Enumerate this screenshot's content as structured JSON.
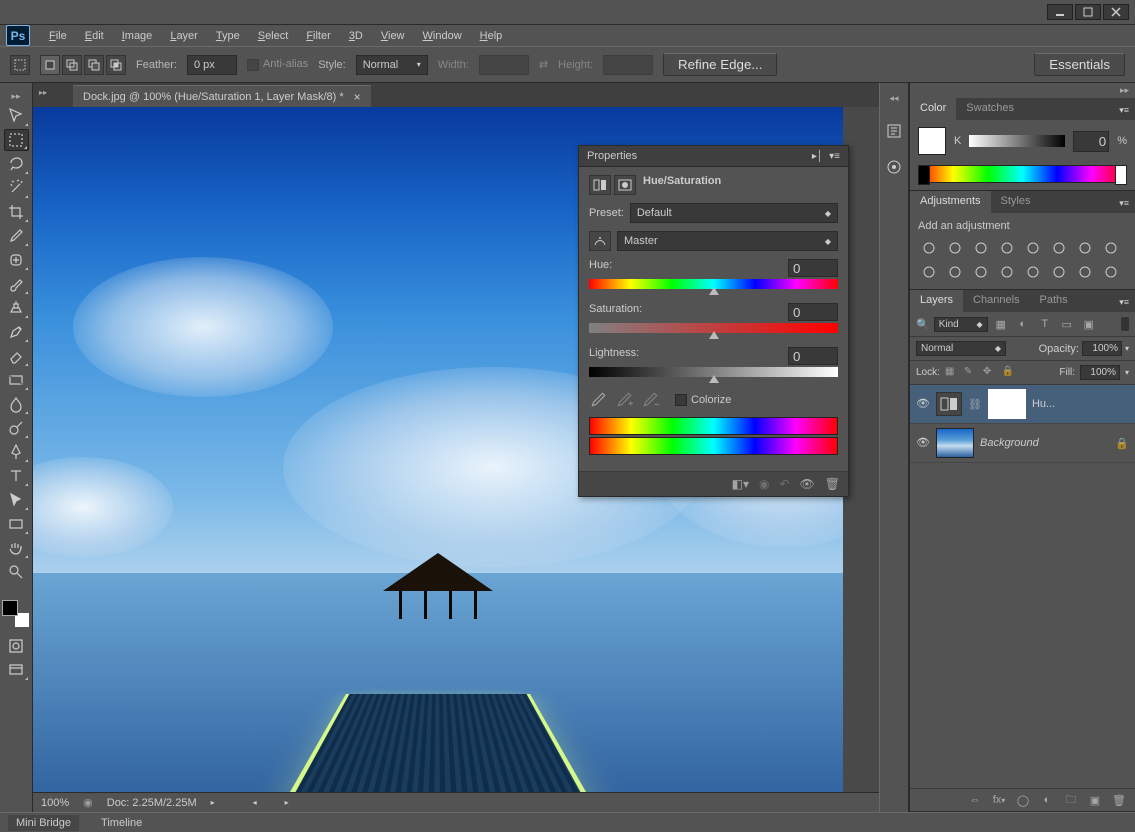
{
  "menubar": [
    "File",
    "Edit",
    "Image",
    "Layer",
    "Type",
    "Select",
    "Filter",
    "3D",
    "View",
    "Window",
    "Help"
  ],
  "optbar": {
    "feather_label": "Feather:",
    "feather_value": "0 px",
    "antialias_label": "Anti-alias",
    "style_label": "Style:",
    "style_value": "Normal",
    "width_label": "Width:",
    "height_label": "Height:",
    "refine_btn": "Refine Edge...",
    "essentials_btn": "Essentials"
  },
  "doc": {
    "tab_title": "Dock.jpg @ 100% (Hue/Saturation 1, Layer Mask/8) *"
  },
  "properties": {
    "title": "Properties",
    "subtitle": "Hue/Saturation",
    "preset_label": "Preset:",
    "preset_value": "Default",
    "channel_value": "Master",
    "hue_label": "Hue:",
    "hue_value": "0",
    "sat_label": "Saturation:",
    "sat_value": "0",
    "light_label": "Lightness:",
    "light_value": "0",
    "colorize_label": "Colorize"
  },
  "color_panel": {
    "tab_color": "Color",
    "tab_swatches": "Swatches",
    "k_label": "K",
    "k_value": "0",
    "k_unit": "%"
  },
  "adjustments_panel": {
    "tab_adjustments": "Adjustments",
    "tab_styles": "Styles",
    "heading": "Add an adjustment"
  },
  "layers_panel": {
    "tab_layers": "Layers",
    "tab_channels": "Channels",
    "tab_paths": "Paths",
    "kind_label": "Kind",
    "blend_value": "Normal",
    "opacity_label": "Opacity:",
    "opacity_value": "100%",
    "lock_label": "Lock:",
    "fill_label": "Fill:",
    "fill_value": "100%",
    "layers": [
      {
        "name": "Hu...",
        "type": "adjustment"
      },
      {
        "name": "Background",
        "type": "bg"
      }
    ]
  },
  "statusbar": {
    "zoom": "100%",
    "docinfo": "Doc: 2.25M/2.25M",
    "tab_minibridge": "Mini Bridge",
    "tab_timeline": "Timeline"
  }
}
